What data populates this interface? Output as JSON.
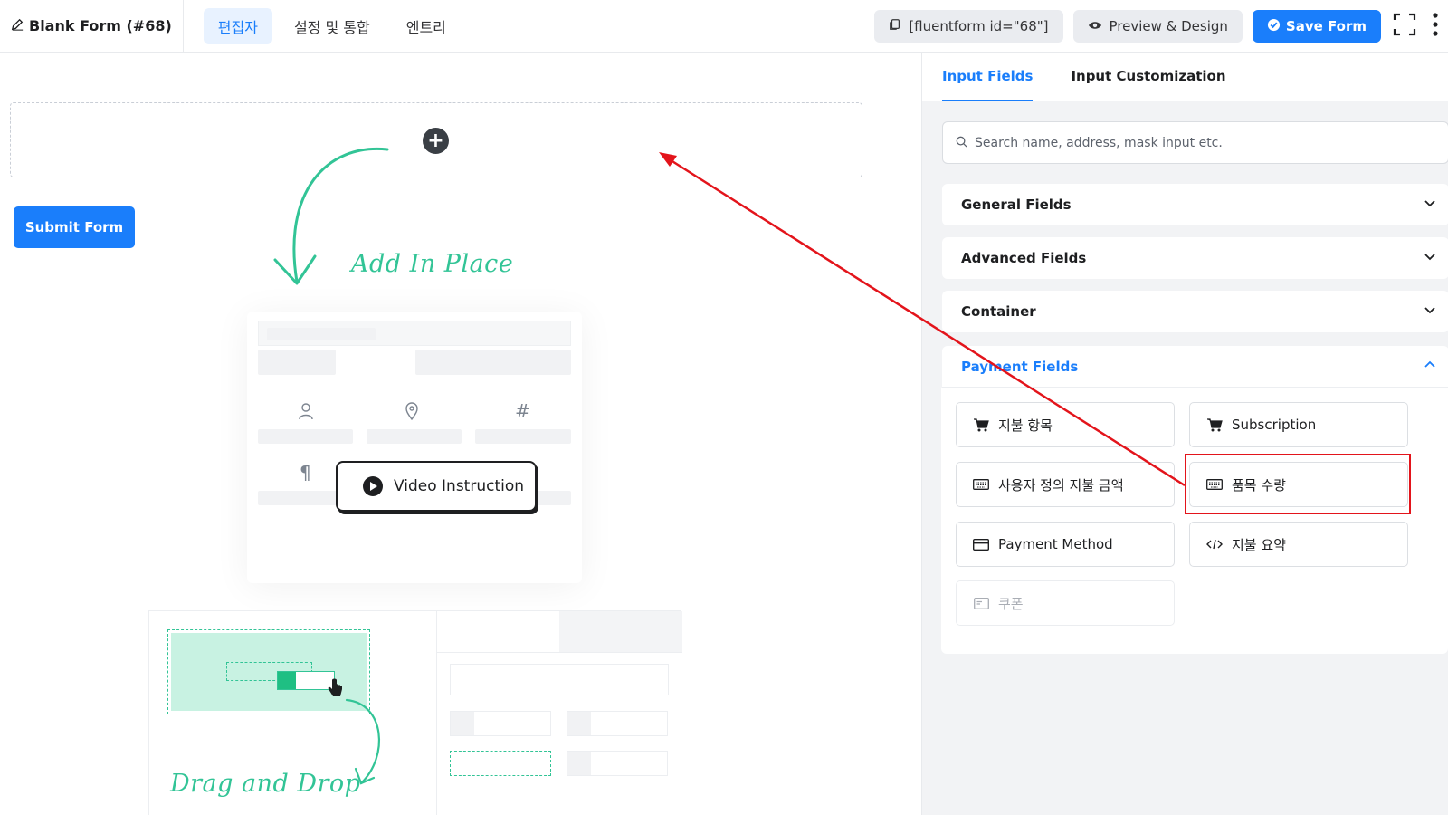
{
  "header": {
    "form_title": "Blank Form (#68)",
    "tabs": [
      {
        "label": "편집자",
        "active": true
      },
      {
        "label": "설정 및 통합",
        "active": false
      },
      {
        "label": "엔트리",
        "active": false
      }
    ],
    "shortcode_label": "[fluentform id=\"68\"]",
    "preview_label": "Preview & Design",
    "save_label": "Save Form"
  },
  "canvas": {
    "submit_label": "Submit Form",
    "add_in_place_text": "Add In Place",
    "video_instruction_label": "Video Instruction",
    "drag_and_drop_text": "Drag and Drop"
  },
  "panel": {
    "tabs": [
      {
        "label": "Input Fields",
        "active": true
      },
      {
        "label": "Input Customization",
        "active": false
      }
    ],
    "search_placeholder": "Search name, address, mask input etc.",
    "sections": {
      "general": "General Fields",
      "advanced": "Advanced Fields",
      "container": "Container",
      "payment": "Payment Fields"
    },
    "payment_fields": [
      {
        "label": "지불 항목",
        "icon": "cart-icon"
      },
      {
        "label": "Subscription",
        "icon": "cart-icon"
      },
      {
        "label": "사용자 정의 지불 금액",
        "icon": "keyboard-icon"
      },
      {
        "label": "품목 수량",
        "icon": "keyboard-icon"
      },
      {
        "label": "Payment Method",
        "icon": "credit-card-icon"
      },
      {
        "label": "지불 요약",
        "icon": "code-icon"
      },
      {
        "label": "쿠폰",
        "icon": "coupon-icon",
        "disabled": true
      }
    ]
  },
  "colors": {
    "accent": "#1a7efb",
    "annotation": "#e3141b",
    "hand_green": "#32c496"
  }
}
